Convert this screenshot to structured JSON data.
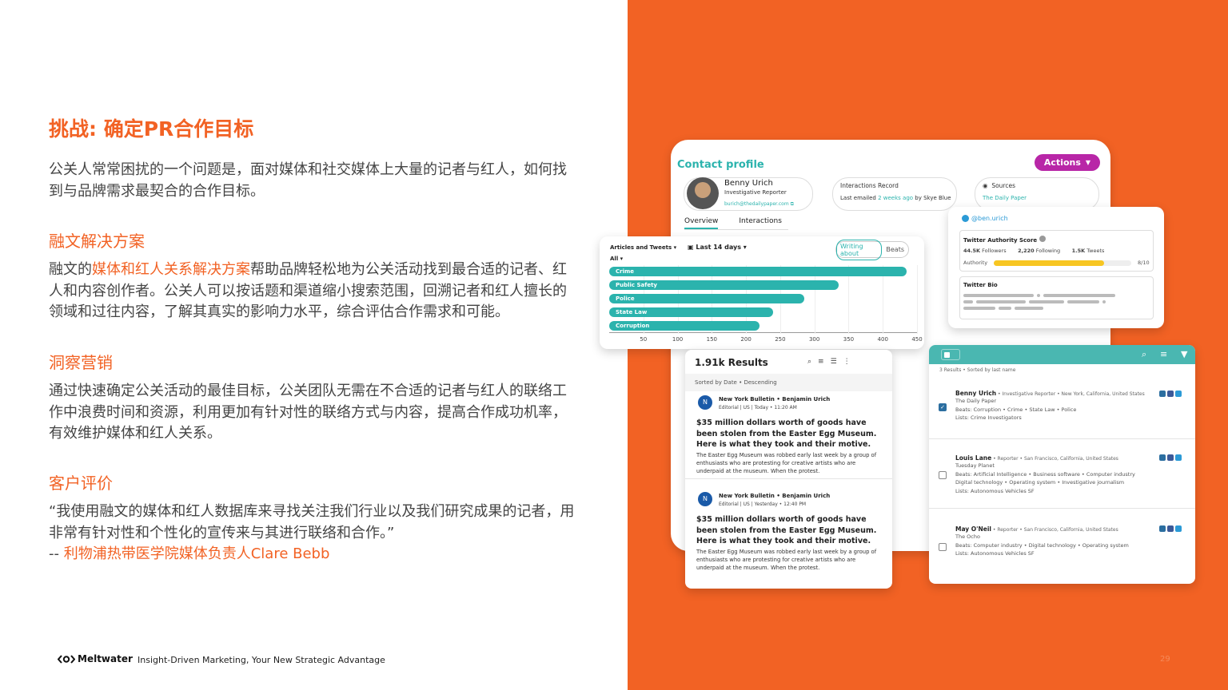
{
  "left": {
    "title": "挑战: 确定PR合作目标",
    "intro": "公关人常常困扰的一个问题是，面对媒体和社交媒体上大量的记者与红人，如何找到与品牌需求最契合的合作目标。",
    "sec1_title": "融文解决方案",
    "sec1_prefix": "融文的",
    "sec1_highlight": "媒体和红人关系解决方案",
    "sec1_rest": "帮助品牌轻松地为公关活动找到最合适的记者、红人和内容创作者。公关人可以按话题和渠道缩小搜索范围，回溯记者和红人擅长的领域和过往内容，了解其真实的影响力水平，综合评估合作需求和可能。",
    "sec2_title": "洞察营销",
    "sec2_body": "通过快速确定公关活动的最佳目标，公关团队无需在不合适的记者与红人的联络工作中浪费时间和资源，利用更加有针对性的联络方式与内容，提高合作成功机率，有效维护媒体和红人关系。",
    "sec3_title": "客户评价",
    "quote": "“我使用融文的媒体和红人数据库来寻找关注我们行业以及我们研究成果的记者，用非常有针对性和个性化的宣传来与其进行联络和合作。”",
    "attribution_prefix": "-- ",
    "attribution": "利物浦热带医学院媒体负责人Clare Bebb"
  },
  "footer": {
    "logo": "Meltwater",
    "tagline": "Insight-Driven Marketing, Your New Strategic Advantage",
    "page": "29"
  },
  "contact": {
    "title": "Contact profile",
    "actions": "Actions",
    "name": "Benny Urich",
    "role": "Investigative Reporter",
    "email": "burich@thedailypaper.com",
    "interactions_title": "Interactions Record",
    "last_emailed_prefix": "Last emailed ",
    "last_emailed_link": "2 weeks ago",
    "last_emailed_suffix": " by Skye Blue",
    "sources_title": "Sources",
    "sources_value": "The Daily Paper",
    "tab_overview": "Overview",
    "tab_interactions": "Interactions"
  },
  "chart_data": {
    "type": "bar",
    "title": "Articles and Tweets",
    "period": "Last 14 days",
    "filter": "All",
    "toggle_on": "Writing about",
    "toggle_off": "Beats",
    "categories": [
      "Crime",
      "Public Safety",
      "Police",
      "State Law",
      "Corruption"
    ],
    "values": [
      435,
      335,
      285,
      240,
      220
    ],
    "xlim": [
      0,
      450
    ],
    "ticks": [
      50,
      100,
      150,
      200,
      250,
      300,
      350,
      400,
      450
    ],
    "color": "#2bb3ad"
  },
  "twitter": {
    "handle": "@ben.urich",
    "score_title": "Twitter Authority Score",
    "followers_value": "44.5K",
    "followers_label": "Followers",
    "following_value": "2,220",
    "following_label": "Following",
    "tweets_value": "1.5K",
    "tweets_label": "Tweets",
    "authority_label": "Authority",
    "authority_value": "8/10",
    "authority_fraction": 0.8,
    "bio_title": "Twitter Bio"
  },
  "results": {
    "count": "1.91k Results",
    "sorted": "Sorted by Date • Descending",
    "articles": [
      {
        "source": "New York Bulletin • Benjamin Urich",
        "meta": "Editorial | US | Today • 11:20 AM",
        "headline": "$35 million dollars worth of goods have been stolen from the Easter Egg Museum. Here is what they took and their motive.",
        "body": "The Easter Egg Museum was robbed early last week by a group of enthusiasts who are protesting for creative artists who are underpaid at the museum. When the protest."
      },
      {
        "source": "New York Bulletin • Benjamin Urich",
        "meta": "Editorial | US | Yesterday • 12:40 PM",
        "headline": "$35 million dollars worth of goods have been stolen from the Easter Egg Museum. Here is what they took and their motive.",
        "body": "The Easter Egg Museum was robbed early last week by a group of enthusiasts who are protesting for creative artists who are underpaid at the museum. When the protest."
      }
    ]
  },
  "list": {
    "summary": "3 Results • Sorted by last name",
    "people": [
      {
        "name": "Benny Urich",
        "detail": " • Investigative Reporter • New York, California, United States",
        "outlet": "The Daily Paper",
        "beats": "Beats: Corruption • Crime • State Law • Police",
        "extra": "",
        "lists": "Lists: Crime Investigators"
      },
      {
        "name": "Louis Lane",
        "detail": " • Reporter • San Francisco, California, United States",
        "outlet": "Tuesday Planet",
        "beats": "Beats: Artificial Intelligence • Business software • Computer industry",
        "extra": "Digital technology • Operating system • Investigative journalism",
        "lists": "Lists: Autonomous Vehicles SF"
      },
      {
        "name": "May O'Neil",
        "detail": " • Reporter • San Francisco, California, United States",
        "outlet": "The Ocho",
        "beats": "Beats: Computer industry • Digital technology • Operating system",
        "extra": "",
        "lists": "Lists: Autonomous Vehicles SF"
      }
    ]
  },
  "colors": {
    "brand_orange": "#f26224",
    "teal": "#2bb3ad",
    "actions_purple": "#b826a7"
  }
}
